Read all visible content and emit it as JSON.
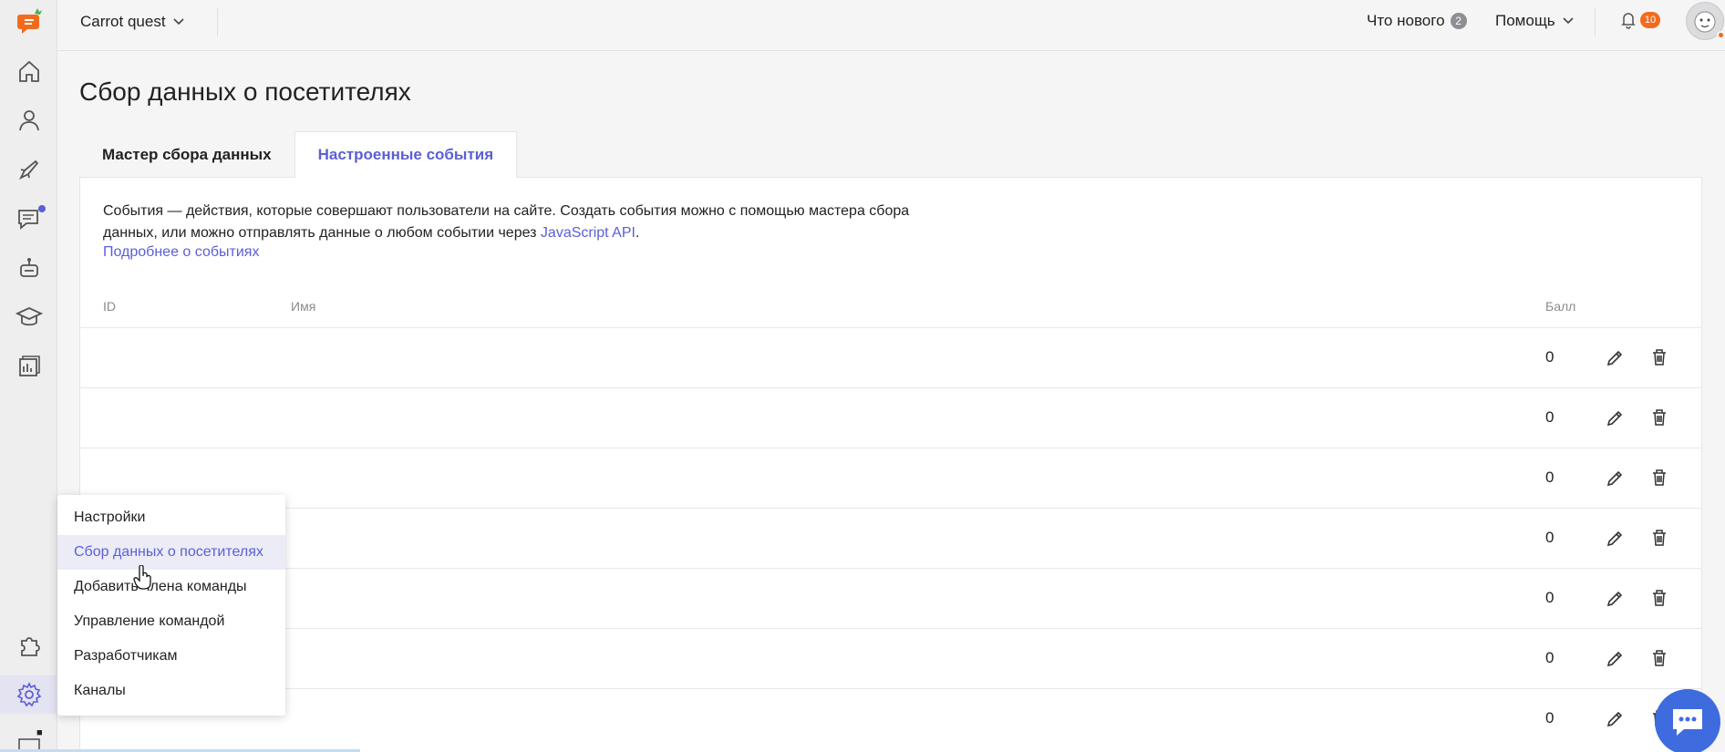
{
  "topbar": {
    "project_name": "Carrot quest",
    "whats_new_label": "Что нового",
    "whats_new_count": "2",
    "help_label": "Помощь",
    "notifications_count": "10"
  },
  "page": {
    "title": "Сбор данных о посетителях"
  },
  "tabs": [
    {
      "label": "Мастер сбора данных",
      "active": false
    },
    {
      "label": "Настроенные события",
      "active": true
    }
  ],
  "intro": {
    "text_part1": "События — действия, которые совершают пользователи на сайте. Создать события можно с помощью мастера сбора данных, или можно отправлять данные о любом событии через ",
    "api_link": "JavaScript API",
    "text_part2": ".",
    "more_link": "Подробнее о событиях"
  },
  "table": {
    "headers": {
      "id": "ID",
      "name": "Имя",
      "score": "Балл"
    },
    "rows": [
      {
        "id": "",
        "name": "",
        "score": "0"
      },
      {
        "id": "",
        "name": "",
        "score": "0"
      },
      {
        "id": "",
        "name": "",
        "score": "0"
      },
      {
        "id": "",
        "name": "",
        "score": "0"
      },
      {
        "id": "",
        "name": "",
        "score": "0"
      },
      {
        "id": "",
        "name": "",
        "score": "0"
      },
      {
        "id": "",
        "name": "",
        "score": "0"
      }
    ]
  },
  "settings_menu": {
    "items": [
      {
        "label": "Настройки",
        "active": false
      },
      {
        "label": "Сбор данных о посетителях",
        "active": true
      },
      {
        "label": "Добавить члена команды",
        "active": false
      },
      {
        "label": "Управление командой",
        "active": false
      },
      {
        "label": "Разработчикам",
        "active": false
      },
      {
        "label": "Каналы",
        "active": false
      }
    ]
  },
  "colors": {
    "accent": "#5b5fd6",
    "brand_orange": "#f26b1d",
    "chat_blue": "#3e6bde"
  },
  "icons": {
    "rail": [
      "home-icon",
      "users-icon",
      "rocket-icon",
      "chat-icon",
      "bot-icon",
      "academy-icon",
      "reports-icon",
      "integrations-icon",
      "settings-icon"
    ]
  }
}
